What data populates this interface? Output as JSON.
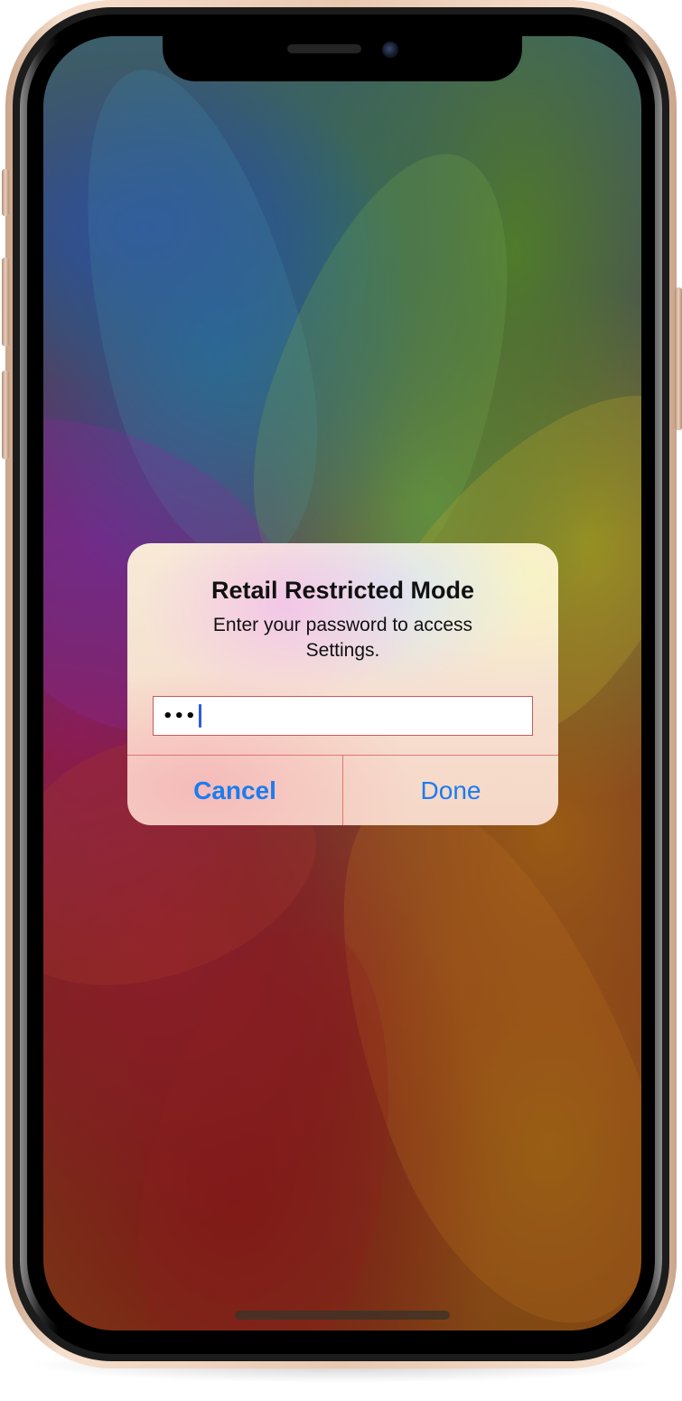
{
  "alert": {
    "title": "Retail Restricted Mode",
    "message": "Enter your password to access Settings.",
    "password_field": {
      "masked_value": "•••"
    },
    "buttons": {
      "cancel_label": "Cancel",
      "done_label": "Done"
    }
  },
  "colors": {
    "accent": "#1a7cf0",
    "caret": "#2e5bd9",
    "field_border": "#c75a5a",
    "frame_gold": "#e9c8b0"
  },
  "icons": {
    "camera": "front-camera-icon",
    "speaker": "earpiece-speaker-icon"
  }
}
